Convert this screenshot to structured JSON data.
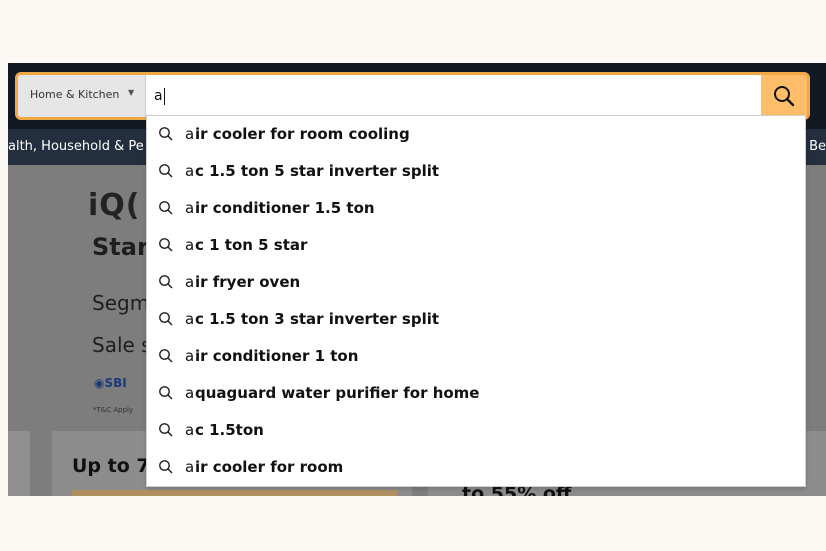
{
  "category": {
    "label": "Home & Kitchen"
  },
  "search": {
    "value": "a"
  },
  "nav": {
    "left_text": "alth, Household & Pe",
    "right_text": "Be"
  },
  "banner": {
    "brand": "iQ(",
    "line1": "Star",
    "line2": "Segm",
    "line3": "Sale s",
    "bank": "SBI",
    "tc": "*T&C Apply"
  },
  "deals": {
    "title": "Up to 7",
    "subtitle": "to 55% off"
  },
  "suggestions": [
    {
      "prefix": "a",
      "rest": "ir cooler for room cooling"
    },
    {
      "prefix": "a",
      "rest": "c 1.5 ton 5 star inverter split"
    },
    {
      "prefix": "a",
      "rest": "ir conditioner 1.5 ton"
    },
    {
      "prefix": "a",
      "rest": "c 1 ton 5 star"
    },
    {
      "prefix": "a",
      "rest": "ir fryer oven"
    },
    {
      "prefix": "a",
      "rest": "c 1.5 ton 3 star inverter split"
    },
    {
      "prefix": "a",
      "rest": "ir conditioner 1 ton"
    },
    {
      "prefix": "a",
      "rest": "quaguard water purifier for home"
    },
    {
      "prefix": "a",
      "rest": "c 1.5ton"
    },
    {
      "prefix": "a",
      "rest": "ir cooler for room"
    }
  ],
  "colors": {
    "accent": "#febd69",
    "focus_border": "#f3a847",
    "header": "#131921",
    "nav": "#232f3e"
  }
}
